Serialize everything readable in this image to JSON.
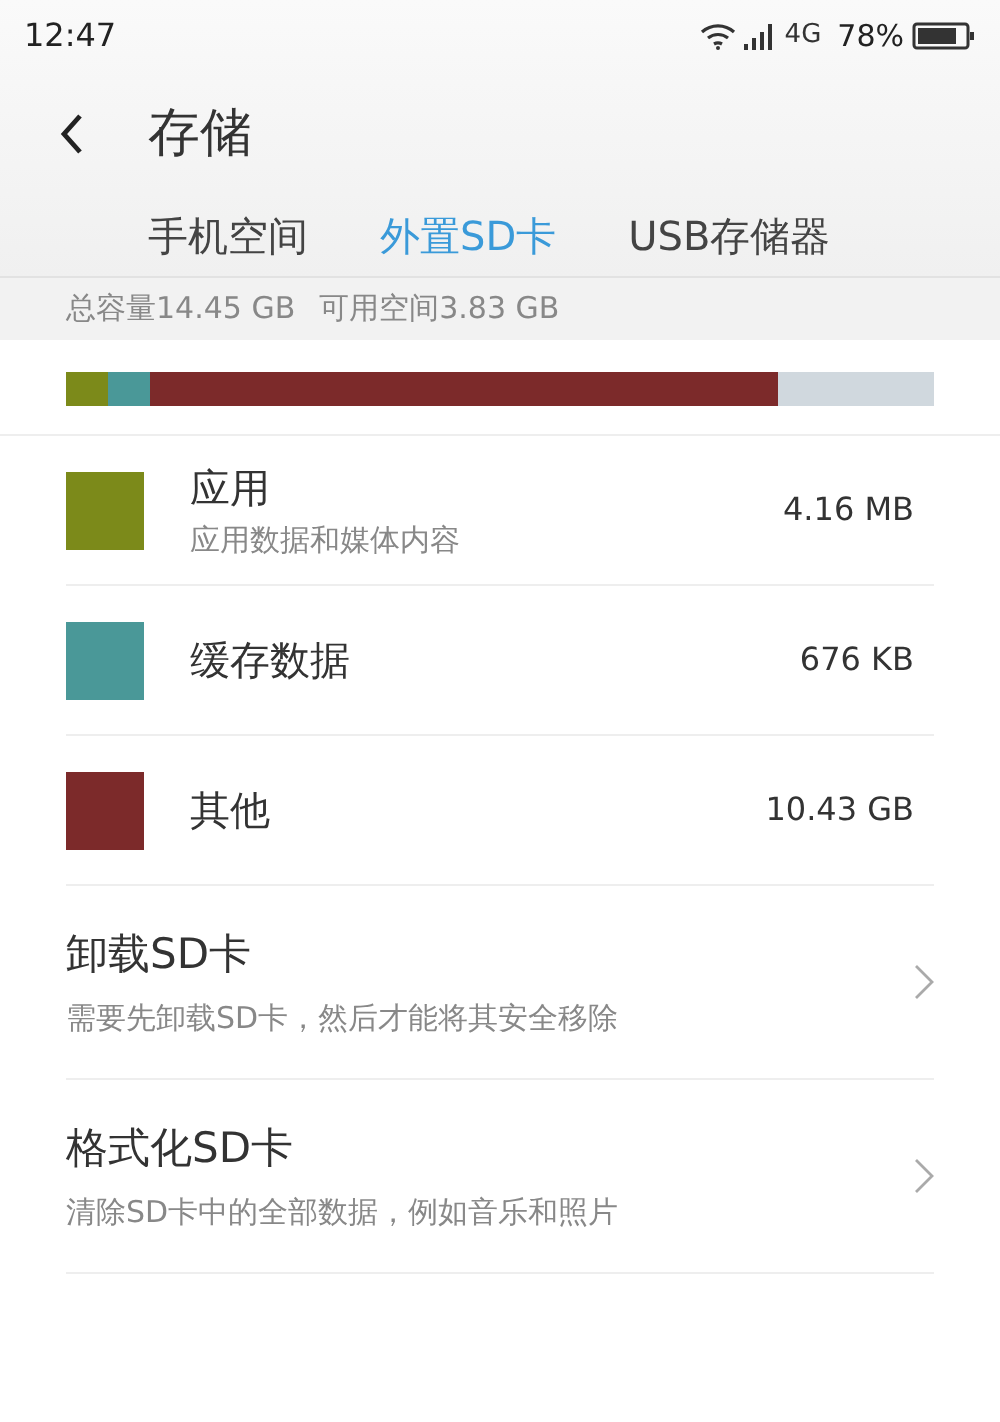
{
  "status_bar": {
    "time": "12:47",
    "network": "4G",
    "battery": "78%"
  },
  "header": {
    "title": "存储"
  },
  "tabs": [
    {
      "label": "手机空间",
      "selected": false
    },
    {
      "label": "外置SD卡",
      "selected": true
    },
    {
      "label": "USB存储器",
      "selected": false
    }
  ],
  "summary": {
    "total": "总容量14.45 GB",
    "free": "可用空间3.83 GB"
  },
  "usage_bar": [
    {
      "color": "#7c8a1a",
      "level": 0.048
    },
    {
      "color": "#4a9898",
      "level": 0.097
    },
    {
      "color": "#7c2a2a",
      "level": 0.82
    }
  ],
  "categories": [
    {
      "name": "应用",
      "detail": "应用数据和媒体内容",
      "size": "4.16 MB",
      "color": "#7c8a1a"
    },
    {
      "name": "缓存数据",
      "size": "676 KB",
      "color": "#4a9898"
    },
    {
      "name": "其他",
      "size": "10.43 GB",
      "color": "#7c2a2a"
    }
  ],
  "actions": [
    {
      "title": "卸载SD卡",
      "description": "需要先卸载SD卡，然后才能将其安全移除"
    },
    {
      "title": "格式化SD卡",
      "description": "清除SD卡中的全部数据，例如音乐和照片"
    }
  ]
}
